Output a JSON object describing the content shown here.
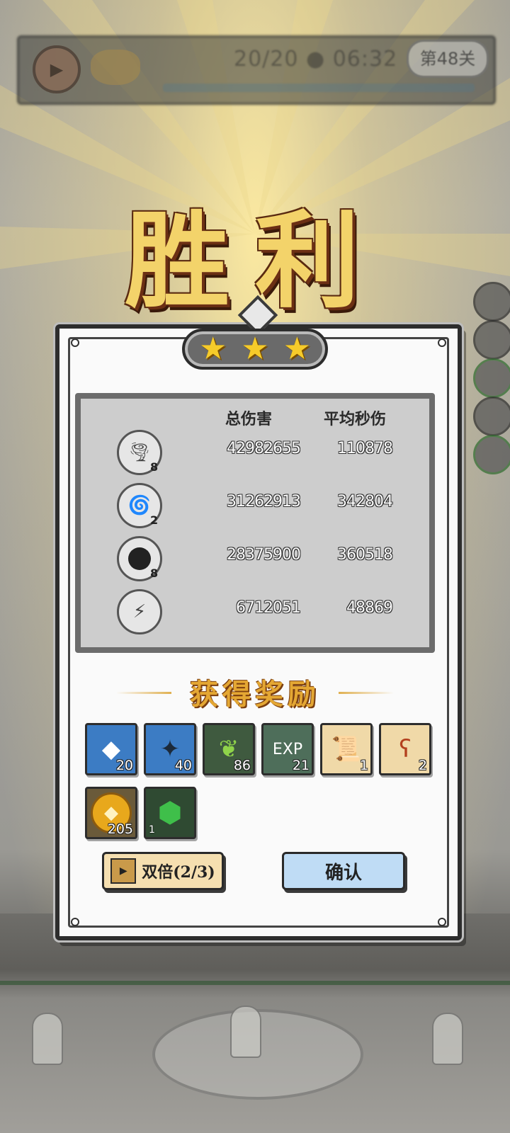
{
  "hud": {
    "wave": "20/20",
    "timer": "06:32",
    "level": "第48关"
  },
  "title": "胜利",
  "stars": 3,
  "stats": {
    "headers": {
      "total": "总伤害",
      "dps": "平均秒伤"
    },
    "rows": [
      {
        "icon": "tornado-skill-icon",
        "level": "8",
        "total": "42982655",
        "dps": "110878"
      },
      {
        "icon": "drill-skill-icon",
        "level": "2",
        "total": "31262913",
        "dps": "342804"
      },
      {
        "icon": "bomb-skill-icon",
        "level": "8",
        "total": "28375900",
        "dps": "360518"
      },
      {
        "icon": "lightning-skill-icon",
        "level": "",
        "total": "6712051",
        "dps": "48869"
      }
    ]
  },
  "rewards": {
    "title": "获得奖励",
    "items": [
      {
        "icon": "blue-crystal-stone-icon",
        "qty": "20",
        "bg": "#3c7cc4"
      },
      {
        "icon": "blue-crystal-ink-icon",
        "qty": "40",
        "bg": "#3c7cc4"
      },
      {
        "icon": "green-leaf-medal-icon",
        "qty": "86",
        "bg": "#3f5a3f"
      },
      {
        "icon": "exp-orb-icon",
        "qty": "21",
        "bg": "#4e6e5a"
      },
      {
        "icon": "scroll-red-icon",
        "qty": "1",
        "bg": "#5a4a3a"
      },
      {
        "icon": "scroll-hook-icon",
        "qty": "2",
        "bg": "#5a4a3a"
      },
      {
        "icon": "gold-coin-icon",
        "qty": "205",
        "bg": "#6a5a3a"
      },
      {
        "icon": "green-gem-icon",
        "qty": "1",
        "bg": "#2f4a32"
      }
    ],
    "exp_label": "EXP"
  },
  "buttons": {
    "double": "双倍(2/3)",
    "confirm": "确认"
  }
}
